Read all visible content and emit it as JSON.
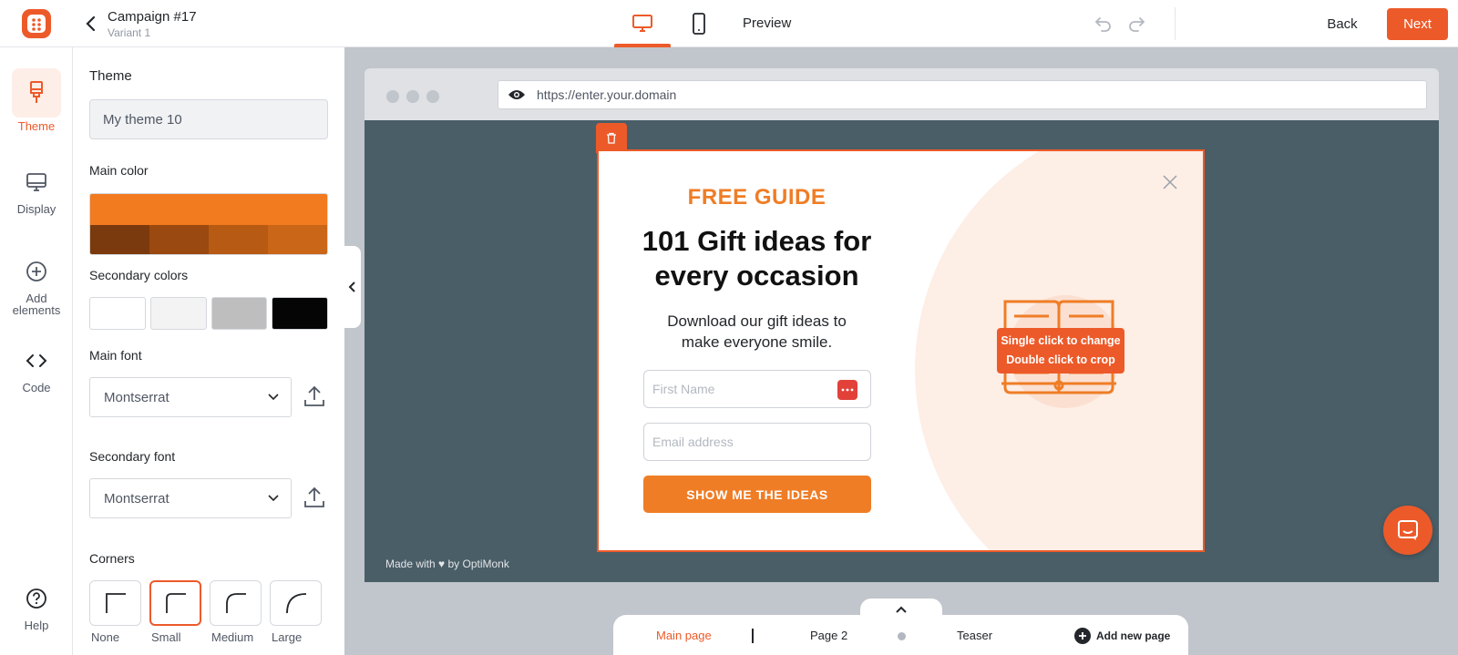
{
  "header": {
    "campaign_title": "Campaign #17",
    "variant": "Variant 1",
    "preview_label": "Preview",
    "back_label": "Back",
    "next_label": "Next"
  },
  "nav": {
    "items": [
      {
        "label": "Theme",
        "icon": "paintbrush-icon",
        "active": true
      },
      {
        "label": "Display",
        "icon": "monitor-icon"
      },
      {
        "label": "Add elements",
        "icon": "plus-circle-icon"
      },
      {
        "label": "Code",
        "icon": "code-icon"
      },
      {
        "label": "Help",
        "icon": "help-icon"
      }
    ]
  },
  "panel": {
    "theme_label": "Theme",
    "theme_value": "My theme 10",
    "main_color_label": "Main color",
    "main_color": "#f27a1f",
    "main_color_shades": [
      "#7a3a0d",
      "#9a4910",
      "#b65a14",
      "#c96618"
    ],
    "secondary_colors_label": "Secondary colors",
    "secondary_colors": [
      "#ffffff",
      "#f3f3f3",
      "#bebebe",
      "#050505"
    ],
    "main_font_label": "Main font",
    "main_font_value": "Montserrat",
    "secondary_font_label": "Secondary font",
    "secondary_font_value": "Montserrat",
    "corners_label": "Corners",
    "corners": [
      {
        "label": "None"
      },
      {
        "label": "Small",
        "selected": true
      },
      {
        "label": "Medium"
      },
      {
        "label": "Large"
      }
    ]
  },
  "browser": {
    "url": "https://enter.your.domain",
    "footer_text": "Made with ♥ by OptiMonk"
  },
  "popup": {
    "kicker": "FREE GUIDE",
    "headline_line1": "101 Gift ideas for",
    "headline_line2": "every occasion",
    "subtext_line1": "Download our gift ideas to",
    "subtext_line2": "make everyone smile.",
    "first_name_placeholder": "First Name",
    "email_placeholder": "Email address",
    "cta_label": "SHOW ME THE IDEAS",
    "image_tooltip_line1": "Single click to change",
    "image_tooltip_line2": "Double click to crop"
  },
  "pages": {
    "tabs": [
      {
        "label": "Main page",
        "active": true
      },
      {
        "label": "Page 2"
      },
      {
        "label": "Teaser"
      }
    ],
    "add_label": "Add new page"
  },
  "colors": {
    "accent": "#ed5a29",
    "popup_orange": "#ef7d26",
    "site_bg": "#4a5e67"
  }
}
